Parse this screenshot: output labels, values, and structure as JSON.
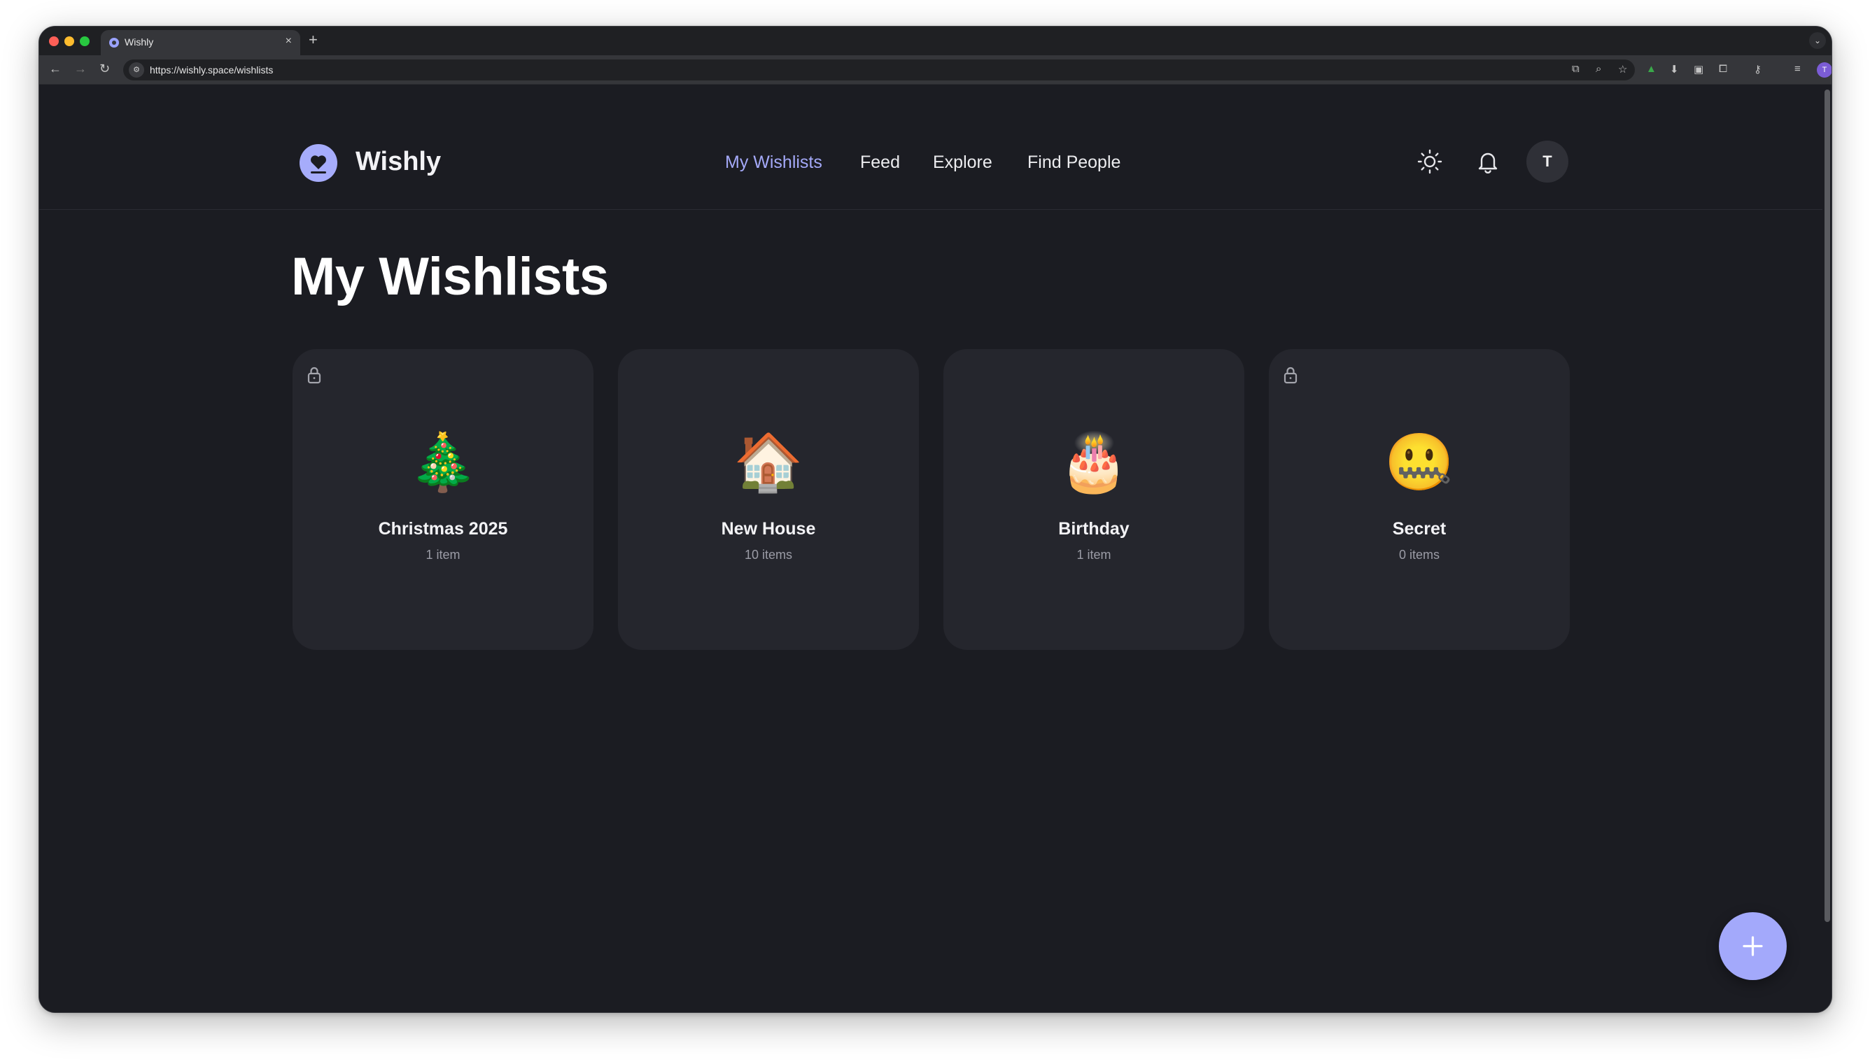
{
  "browser": {
    "tab_title": "Wishly",
    "tab_close": "×",
    "new_tab": "+",
    "url": "https://wishly.space/wishlists",
    "profile_initial": "T",
    "tab_menu": "⌄"
  },
  "header": {
    "brand": "Wishly",
    "nav": [
      "My Wishlists",
      "Feed",
      "Explore",
      "Find People"
    ],
    "active_nav": "My Wishlists",
    "avatar_initial": "T"
  },
  "main": {
    "title": "My Wishlists",
    "wishlists": [
      {
        "emoji": "🎄",
        "name": "Christmas 2025",
        "count": "1 item",
        "private": true
      },
      {
        "emoji": "🏠",
        "name": "New House",
        "count": "10 items",
        "private": false
      },
      {
        "emoji": "🎂",
        "name": "Birthday",
        "count": "1 item",
        "private": false
      },
      {
        "emoji": "🤐",
        "name": "Secret",
        "count": "0 items",
        "private": true
      }
    ]
  },
  "fab": {
    "icon": "plus-icon"
  },
  "colors": {
    "accent": "#a4a9f8",
    "background": "#1b1c22",
    "card": "#25262d",
    "text": "#f3f3f6",
    "muted": "#9b9ca6"
  }
}
